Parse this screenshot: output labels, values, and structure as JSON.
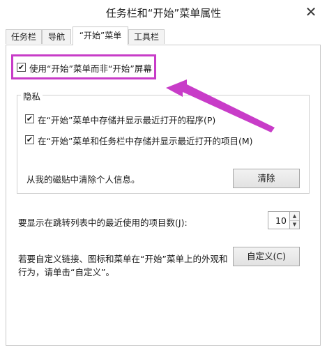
{
  "window": {
    "title": "任务栏和“开始”菜单属性",
    "close": "✕"
  },
  "tabs": [
    {
      "label": "任务栏",
      "active": false
    },
    {
      "label": "导航",
      "active": false
    },
    {
      "label": "“开始”菜单",
      "active": true
    },
    {
      "label": "工具栏",
      "active": false
    }
  ],
  "start_screen_option": {
    "label": "使用“开始”菜单而非“开始”屏幕",
    "checked": true
  },
  "privacy": {
    "legend": "隐私",
    "store_programs": {
      "label": "在“开始”菜单中存储并显示最近打开的程序(P)",
      "checked": true
    },
    "store_items": {
      "label": "在“开始”菜单和任务栏中存储并显示最近打开的项目(M)",
      "checked": true
    },
    "clear_text": "从我的磁贴中清除个人信息。",
    "clear_button": "清除"
  },
  "jumplist": {
    "label": "要显示在跳转列表中的最近使用的项目数(J):",
    "value": "10"
  },
  "customize": {
    "text_line1": "若要自定义链接、图标和菜单在“开始”菜单上的外观和",
    "text_line2": "行为，请单击“自定义”。",
    "button": "自定义(C)"
  },
  "check_glyph": "✔",
  "colors": {
    "annotation": "#c83cc8"
  }
}
